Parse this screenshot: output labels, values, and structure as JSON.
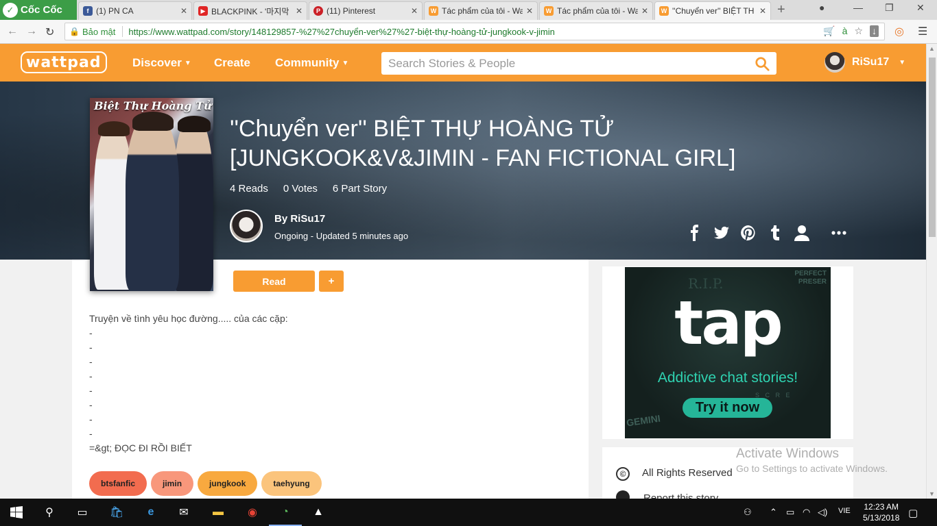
{
  "browser": {
    "brand": "Cốc Cốc",
    "tabs": [
      {
        "label": "(1) PN CA",
        "favicon": "facebook-icon",
        "color": "#3b5998"
      },
      {
        "label": "BLACKPINK - '마지막",
        "favicon": "youtube-icon",
        "color": "#e02626"
      },
      {
        "label": "(11) Pinterest",
        "favicon": "pinterest-icon",
        "color": "#cb2027"
      },
      {
        "label": "Tác phẩm của tôi - Wa",
        "favicon": "wattpad-icon",
        "color": "#f89c32"
      },
      {
        "label": "Tác phẩm của tôi - Wa",
        "favicon": "wattpad-icon",
        "color": "#f89c32"
      },
      {
        "label": "''Chuyển ver'' BIỆT TH",
        "favicon": "wattpad-icon",
        "color": "#f89c32"
      }
    ],
    "secure_label": "Bảo mật",
    "url": "https://www.wattpad.com/story/148129857-%27%27chuyển-ver%27%27-biệt-thự-hoàng-tử-jungkook-v-jimin"
  },
  "wattpad": {
    "logo": "wattpad",
    "nav": {
      "discover": "Discover",
      "create": "Create",
      "community": "Community"
    },
    "search_placeholder": "Search Stories & People",
    "username": "RiSu17",
    "accent": "#f89c32"
  },
  "story": {
    "title": "''Chuyển ver'' BIỆT THỰ HOÀNG TỬ [JUNGKOOK&V&JIMIN - FAN FICTIONAL GIRL]",
    "cover_title": "Biệt Thự Hoàng Tử",
    "reads": "4 Reads",
    "votes": "0 Votes",
    "parts": "6 Part Story",
    "author_by": "By RiSu17",
    "status": "Ongoing - Updated 5 minutes ago",
    "read_label": "Read",
    "add_label": "+",
    "description": [
      "Truyện về tình yêu học đường..... của các cặp:",
      "-",
      "-",
      "-",
      "-",
      "-",
      "-",
      "-",
      "-",
      "=&gt; ĐỌC ĐI RỒI BIẾT"
    ],
    "tags": [
      {
        "label": "btsfanfic",
        "color": "#f26c4f"
      },
      {
        "label": "jimin",
        "color": "#f8977b"
      },
      {
        "label": "jungkook",
        "color": "#f8a93f"
      },
      {
        "label": "taehyung",
        "color": "#fbc47c"
      }
    ]
  },
  "ad": {
    "corner_text": "PERFECT PRESER",
    "rip_text": "R.I.P.",
    "gem_text": "GEMINI",
    "scream_text": "S C R E",
    "logo": "tap",
    "tagline": "Addictive chat stories!",
    "cta": "Try it now"
  },
  "sidebar": {
    "rights_icon": "©",
    "rights": "All Rights Reserved",
    "report": "Report this story"
  },
  "watermark": {
    "title": "Activate Windows",
    "subtitle": "Go to Settings to activate Windows."
  },
  "taskbar": {
    "language": "VIE",
    "time": "12:23 AM",
    "date": "5/13/2018"
  }
}
